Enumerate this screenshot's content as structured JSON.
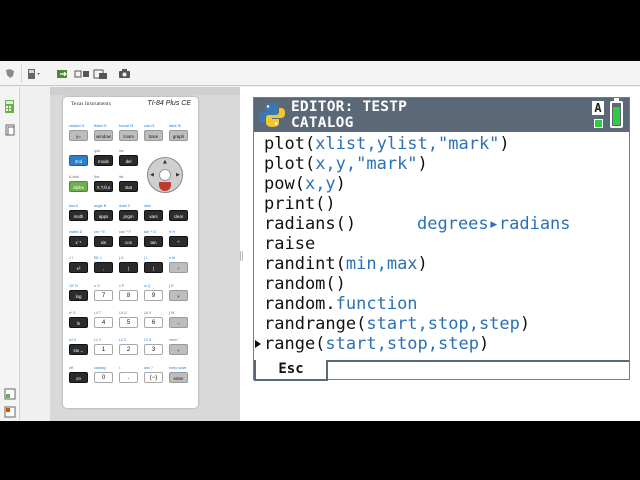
{
  "calculator": {
    "brand": "Texas Instruments",
    "model": "TI-84 Plus CE",
    "rows": [
      [
        {
          "k": "y=",
          "s": "gray",
          "t": "statplot f1"
        },
        {
          "k": "window",
          "s": "gray",
          "t": "tblset f2"
        },
        {
          "k": "zoom",
          "s": "gray",
          "t": "format f3"
        },
        {
          "k": "trace",
          "s": "gray",
          "t": "calc f4"
        },
        {
          "k": "graph",
          "s": "gray",
          "t": "table f5"
        }
      ],
      [
        {
          "k": "2nd",
          "s": "blue",
          "t": ""
        },
        {
          "k": "mode",
          "s": "dark",
          "t": "quit"
        },
        {
          "k": "del",
          "s": "dark",
          "t": "ins"
        }
      ],
      [
        {
          "k": "alpha",
          "s": "green",
          "t": "A-lock"
        },
        {
          "k": "X,T,θ,n",
          "s": "dark",
          "t": "link"
        },
        {
          "k": "stat",
          "s": "dark",
          "t": "list"
        }
      ],
      [
        {
          "k": "math",
          "s": "dark",
          "t": "test A"
        },
        {
          "k": "apps",
          "s": "dark",
          "t": "angle B"
        },
        {
          "k": "prgm",
          "s": "dark",
          "t": "draw C"
        },
        {
          "k": "vars",
          "s": "dark",
          "t": "distr"
        },
        {
          "k": "clear",
          "s": "dark",
          "t": ""
        }
      ],
      [
        {
          "k": "x⁻¹",
          "s": "dark",
          "t": "matrix D"
        },
        {
          "k": "sin",
          "s": "dark",
          "t": "sin⁻¹ E"
        },
        {
          "k": "cos",
          "s": "dark",
          "t": "cos⁻¹ F"
        },
        {
          "k": "tan",
          "s": "dark",
          "t": "tan⁻¹ G"
        },
        {
          "k": "^",
          "s": "dark",
          "t": "π H"
        }
      ],
      [
        {
          "k": "x²",
          "s": "dark",
          "t": "√ I"
        },
        {
          "k": ",",
          "s": "dark",
          "t": "EE J"
        },
        {
          "k": "(",
          "s": "dark",
          "t": "{ K"
        },
        {
          "k": ")",
          "s": "dark",
          "t": "} L"
        },
        {
          "k": "÷",
          "s": "gray",
          "t": "e M"
        }
      ],
      [
        {
          "k": "log",
          "s": "dark",
          "t": "10ˣ N"
        },
        {
          "k": "7",
          "s": "num",
          "t": "u O"
        },
        {
          "k": "8",
          "s": "num",
          "t": "v P"
        },
        {
          "k": "9",
          "s": "num",
          "t": "w Q"
        },
        {
          "k": "×",
          "s": "gray",
          "t": "[ R"
        }
      ],
      [
        {
          "k": "ln",
          "s": "dark",
          "t": "eˣ S"
        },
        {
          "k": "4",
          "s": "num",
          "t": "L4 T"
        },
        {
          "k": "5",
          "s": "num",
          "t": "L5 U"
        },
        {
          "k": "6",
          "s": "num",
          "t": "L6 V"
        },
        {
          "k": "−",
          "s": "gray",
          "t": "] W"
        }
      ],
      [
        {
          "k": "sto→",
          "s": "dark",
          "t": "rcl X"
        },
        {
          "k": "1",
          "s": "num",
          "t": "L1 Y"
        },
        {
          "k": "2",
          "s": "num",
          "t": "L2 Z"
        },
        {
          "k": "3",
          "s": "num",
          "t": "L3 θ"
        },
        {
          "k": "+",
          "s": "gray",
          "t": "mem \""
        }
      ],
      [
        {
          "k": "on",
          "s": "dark",
          "t": "off"
        },
        {
          "k": "0",
          "s": "num",
          "t": "catalog"
        },
        {
          "k": ".",
          "s": "num",
          "t": "i :"
        },
        {
          "k": "(−)",
          "s": "num",
          "t": "ans ?"
        },
        {
          "k": "enter",
          "s": "gray",
          "t": "entry solve"
        }
      ]
    ]
  },
  "screen": {
    "title": "EDITOR: TESTP",
    "subtitle": "CATALOG",
    "alpha_indicator": "A",
    "battery_level": 0.85,
    "lines": [
      {
        "fn": "plot(",
        "args": "xlist,ylist,\"mark\"",
        "close": ")",
        "hint": "",
        "selected": false
      },
      {
        "fn": "plot(",
        "args": "x,y,\"mark\"",
        "close": ")",
        "hint": "",
        "selected": false
      },
      {
        "fn": "pow(",
        "args": "x,y",
        "close": ")",
        "hint": "",
        "selected": false
      },
      {
        "fn": "print()",
        "args": "",
        "close": "",
        "hint": "",
        "selected": false
      },
      {
        "fn": "radians()",
        "args": "",
        "close": "",
        "hint": "degrees▸radians",
        "selected": false
      },
      {
        "fn": "raise",
        "args": "",
        "close": "",
        "hint": "",
        "selected": false
      },
      {
        "fn": "randint(",
        "args": "min,max",
        "close": ")",
        "hint": "",
        "selected": false
      },
      {
        "fn": "random()",
        "args": "",
        "close": "",
        "hint": "",
        "selected": false
      },
      {
        "fn": "random.",
        "args": "function",
        "close": "",
        "hint": "",
        "selected": false
      },
      {
        "fn": "randrange(",
        "args": "start,stop,step",
        "close": ")",
        "hint": "",
        "selected": false
      },
      {
        "fn": "range(",
        "args": "start,stop,step",
        "close": ")",
        "hint": "",
        "selected": true
      }
    ],
    "softkey": "Esc"
  },
  "colors": {
    "title_bar": "#5b6878",
    "arg_blue": "#2a70b8",
    "indicator_green": "#2ecc40"
  }
}
